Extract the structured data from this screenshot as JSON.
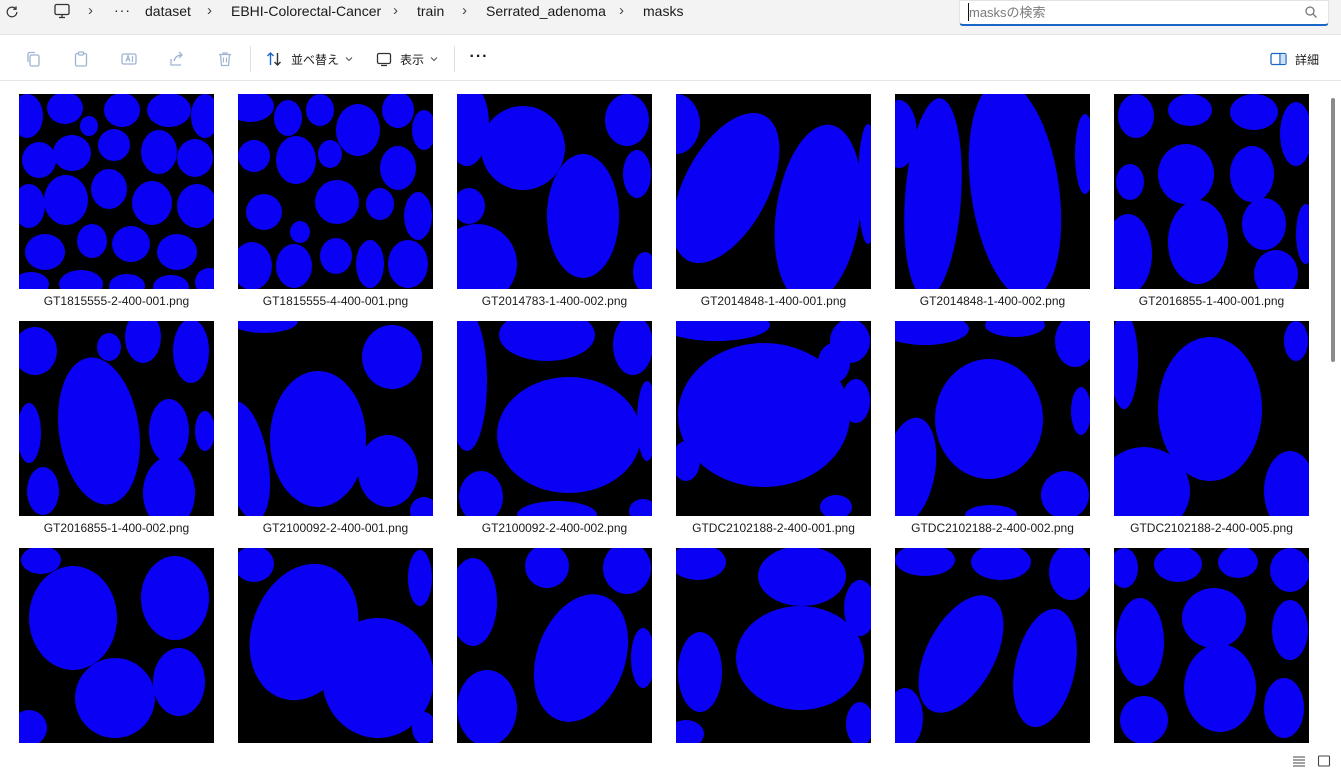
{
  "breadcrumb": {
    "overflow": "···",
    "items": [
      "dataset",
      "EBHI-Colorectal-Cancer",
      "train",
      "Serrated_adenoma",
      "masks"
    ],
    "separator": "›"
  },
  "search": {
    "placeholder": "masksの検索"
  },
  "commandbar": {
    "icons": [
      "copy-icon",
      "paste-icon",
      "rename-icon",
      "share-icon",
      "delete-icon"
    ],
    "sort_label": "並べ替え",
    "view_label": "表示",
    "more_label": "···",
    "details_label": "詳細"
  },
  "colors": {
    "mask_fill": "#0a00f4",
    "mask_background": "#000000",
    "accent": "#1a66c6"
  },
  "files": [
    "GT1815555-2-400-001.png",
    "GT1815555-4-400-001.png",
    "GT2014783-1-400-002.png",
    "GT2014848-1-400-001.png",
    "GT2014848-1-400-002.png",
    "GT2016855-1-400-001.png",
    "GT2016855-1-400-002.png",
    "GT2100092-2-400-001.png",
    "GT2100092-2-400-002.png",
    "GTDC2102188-2-400-001.png",
    "GTDC2102188-2-400-002.png",
    "GTDC2102188-2-400-005.png",
    "",
    "",
    "",
    "",
    "",
    ""
  ],
  "statusbar": {
    "icons": [
      "details-view-icon",
      "large-icons-view-icon"
    ]
  }
}
